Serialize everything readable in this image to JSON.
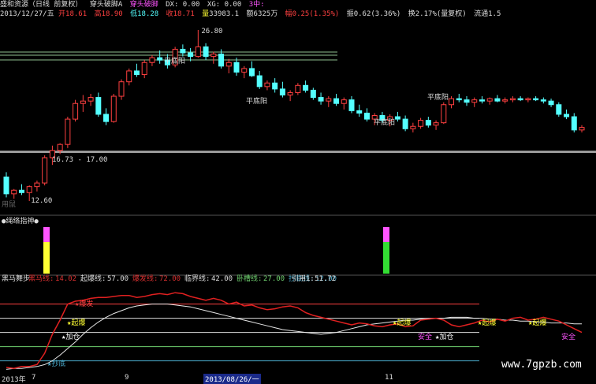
{
  "header": {
    "title": "盛和资源（日线 前复权）",
    "indicator": "穿头破脚A",
    "indicator2": "穿头破脚",
    "dx_label": "DX: 0.00",
    "xg_label": "XG: 0.00",
    "buy_label": "3中:"
  },
  "quote": {
    "date": "2013/12/27/五",
    "open_label": "开",
    "open": "18.61",
    "high_label": "高",
    "high": "18.90",
    "low_label": "低",
    "low": "18.28",
    "close_label": "收",
    "close": "18.71",
    "vol_label": "量",
    "vol": "33983.1",
    "amount_label": "额",
    "amount": "6325万",
    "chg_label": "幅",
    "chg": "0.25(1.35%)",
    "amp_label": "振",
    "amp": "0.62(3.36%)",
    "turn_label": "换",
    "turn": "2.17%(量复权)",
    "flow_label": "流通1.5"
  },
  "annotations": {
    "high_price": "26.80",
    "low_price": "12.60",
    "range_text": "16.73 - 17.00",
    "pingdiyang": "平底阳",
    "use_tip": "用鼠"
  },
  "panel2": {
    "title": "●绳络指神●"
  },
  "panel3": {
    "name": "黑马舞步",
    "items": [
      {
        "label": "黑马线:",
        "value": "14.02",
        "color": "#d93030"
      },
      {
        "label": "起爆线:",
        "value": "57.00",
        "color": "#dddddd"
      },
      {
        "label": "爆发线:",
        "value": "72.00",
        "color": "#d93030"
      },
      {
        "label": "临界线:",
        "value": "42.00",
        "color": "#dddddd"
      },
      {
        "label": "卧槽线:",
        "value": "27.00",
        "color": "#6fd06f"
      },
      {
        "label": "抄底线:",
        "value": "12.00",
        "color": "#49a7c7"
      }
    ],
    "ref_label": "引用1:",
    "ref_value": "51.72",
    "labels": {
      "qibao": "★起爆",
      "jiacang": "★加仓",
      "baofa": "★爆发",
      "chaodi": "★抄底",
      "anquan": "安全"
    }
  },
  "axis": {
    "left_year": "2013年",
    "ticks": [
      "7",
      "9",
      "11"
    ],
    "cursor_date": "2013/08/26/一"
  },
  "watermark": "www.7gpzb.com",
  "colors": {
    "up": "#ff4040",
    "down": "#54ffff",
    "ma_white": "#e8e8e8",
    "bg": "#000000",
    "hline": "#8fbf8f",
    "magenta": "#ff55ff",
    "yellow": "#ffff33",
    "green": "#33dd33"
  },
  "chart_data": {
    "type": "candlestick",
    "price_axis": {
      "min": 12.6,
      "max": 26.8
    },
    "candles": [
      [
        14.6,
        15.0,
        12.9,
        13.2
      ],
      [
        13.2,
        13.6,
        12.8,
        13.5
      ],
      [
        13.5,
        14.0,
        13.1,
        13.3
      ],
      [
        13.3,
        13.9,
        12.6,
        13.8
      ],
      [
        13.8,
        14.3,
        13.4,
        14.1
      ],
      [
        14.1,
        16.4,
        13.9,
        16.2
      ],
      [
        16.2,
        17.2,
        15.6,
        16.8
      ],
      [
        16.8,
        17.4,
        16.5,
        17.3
      ],
      [
        17.3,
        19.6,
        17.0,
        19.4
      ],
      [
        19.4,
        21.0,
        19.2,
        20.7
      ],
      [
        20.7,
        21.4,
        20.0,
        20.9
      ],
      [
        20.9,
        21.5,
        20.5,
        21.2
      ],
      [
        21.2,
        21.6,
        19.6,
        19.8
      ],
      [
        19.8,
        20.3,
        18.9,
        19.2
      ],
      [
        19.2,
        21.5,
        19.1,
        21.3
      ],
      [
        21.3,
        22.7,
        21.0,
        22.5
      ],
      [
        22.5,
        23.6,
        22.2,
        23.4
      ],
      [
        23.4,
        24.0,
        22.9,
        23.1
      ],
      [
        23.1,
        24.3,
        22.8,
        24.1
      ],
      [
        24.1,
        24.7,
        23.8,
        24.5
      ],
      [
        24.5,
        25.1,
        24.0,
        24.3
      ],
      [
        24.3,
        24.8,
        23.6,
        23.9
      ],
      [
        23.9,
        25.4,
        23.7,
        25.2
      ],
      [
        25.2,
        25.6,
        24.6,
        24.9
      ],
      [
        24.9,
        25.3,
        24.2,
        24.6
      ],
      [
        24.6,
        26.8,
        24.5,
        25.4
      ],
      [
        25.4,
        25.7,
        24.3,
        24.6
      ],
      [
        24.6,
        25.0,
        24.0,
        24.8
      ],
      [
        24.8,
        25.2,
        23.6,
        23.8
      ],
      [
        23.8,
        24.4,
        23.2,
        24.1
      ],
      [
        24.1,
        24.5,
        23.0,
        23.3
      ],
      [
        23.3,
        23.8,
        22.8,
        23.6
      ],
      [
        23.6,
        24.2,
        22.9,
        23.0
      ],
      [
        23.0,
        23.4,
        21.9,
        22.1
      ],
      [
        22.1,
        22.6,
        21.8,
        22.4
      ],
      [
        22.4,
        22.8,
        21.6,
        21.9
      ],
      [
        21.9,
        22.5,
        21.2,
        21.4
      ],
      [
        21.4,
        21.8,
        20.9,
        21.6
      ],
      [
        21.6,
        22.4,
        21.4,
        22.2
      ],
      [
        22.2,
        22.6,
        21.6,
        21.8
      ],
      [
        21.8,
        22.0,
        21.0,
        21.2
      ],
      [
        21.2,
        21.6,
        20.6,
        20.9
      ],
      [
        20.9,
        21.3,
        20.4,
        21.1
      ],
      [
        21.1,
        21.5,
        20.5,
        20.7
      ],
      [
        20.7,
        21.2,
        20.2,
        21.0
      ],
      [
        21.0,
        21.3,
        19.9,
        20.1
      ],
      [
        20.1,
        20.6,
        19.6,
        19.9
      ],
      [
        19.9,
        20.3,
        19.2,
        19.4
      ],
      [
        19.4,
        19.9,
        18.9,
        19.7
      ],
      [
        19.7,
        20.0,
        19.1,
        19.3
      ],
      [
        19.3,
        19.8,
        18.8,
        19.6
      ],
      [
        19.6,
        20.0,
        19.2,
        19.4
      ],
      [
        19.4,
        19.7,
        18.4,
        18.6
      ],
      [
        18.6,
        19.1,
        18.3,
        18.8
      ],
      [
        18.8,
        19.5,
        18.6,
        19.3
      ],
      [
        19.3,
        19.6,
        18.7,
        18.9
      ],
      [
        18.9,
        19.3,
        18.5,
        19.1
      ],
      [
        19.1,
        20.8,
        19.0,
        20.6
      ],
      [
        20.6,
        21.3,
        20.3,
        21.1
      ],
      [
        21.1,
        21.5,
        20.8,
        21.0
      ],
      [
        21.0,
        21.3,
        20.5,
        20.8
      ],
      [
        20.8,
        21.2,
        20.4,
        21.0
      ],
      [
        21.0,
        21.3,
        20.7,
        20.9
      ],
      [
        20.9,
        21.2,
        20.6,
        21.1
      ],
      [
        21.1,
        21.4,
        20.8,
        20.9
      ],
      [
        20.9,
        21.2,
        20.7,
        21.0
      ],
      [
        21.0,
        21.3,
        20.8,
        21.1
      ],
      [
        21.1,
        21.3,
        20.9,
        21.0
      ],
      [
        21.0,
        21.2,
        20.8,
        21.1
      ],
      [
        21.1,
        21.3,
        20.9,
        21.0
      ],
      [
        21.0,
        21.2,
        20.7,
        20.9
      ],
      [
        20.9,
        21.1,
        20.4,
        20.6
      ],
      [
        20.6,
        20.8,
        19.6,
        19.8
      ],
      [
        19.8,
        20.2,
        19.4,
        19.6
      ],
      [
        19.6,
        19.9,
        18.3,
        18.5
      ],
      [
        18.5,
        18.9,
        18.3,
        18.71
      ]
    ],
    "indicator2_bars": [
      {
        "index": 5,
        "top": "#ff55ff",
        "bottom": "#ffff33"
      },
      {
        "index": 55,
        "top": "#ff55ff",
        "bottom": "#33dd33"
      }
    ],
    "panel3_levels": [
      72,
      57,
      42,
      27,
      12
    ],
    "panel3_red": [
      5,
      4,
      6,
      6,
      8,
      20,
      40,
      55,
      72,
      75,
      76,
      78,
      79,
      79,
      80,
      81,
      81,
      79,
      80,
      82,
      83,
      82,
      84,
      83,
      80,
      78,
      76,
      78,
      76,
      72,
      74,
      70,
      71,
      68,
      66,
      67,
      69,
      70,
      68,
      63,
      60,
      58,
      56,
      54,
      52,
      50,
      52,
      51,
      49,
      48,
      50,
      51,
      48,
      49,
      55,
      56,
      57,
      55,
      50,
      48,
      50,
      52,
      55,
      53,
      56,
      54,
      57,
      58,
      55,
      56,
      58,
      56,
      54,
      50,
      46,
      42
    ],
    "panel3_white": [
      3,
      4,
      4,
      5,
      6,
      8,
      12,
      18,
      25,
      32,
      40,
      47,
      53,
      58,
      62,
      65,
      68,
      70,
      71,
      72,
      72,
      72,
      71,
      70,
      69,
      67,
      65,
      63,
      61,
      59,
      57,
      55,
      53,
      51,
      49,
      47,
      45,
      44,
      43,
      42,
      41,
      40,
      41,
      42,
      44,
      46,
      48,
      50,
      51,
      52,
      53,
      54,
      55,
      55,
      56,
      56,
      57,
      57,
      58,
      58,
      58,
      57,
      57,
      56,
      56,
      55,
      55,
      54,
      54,
      53,
      53,
      52,
      52,
      52,
      51,
      51
    ]
  }
}
